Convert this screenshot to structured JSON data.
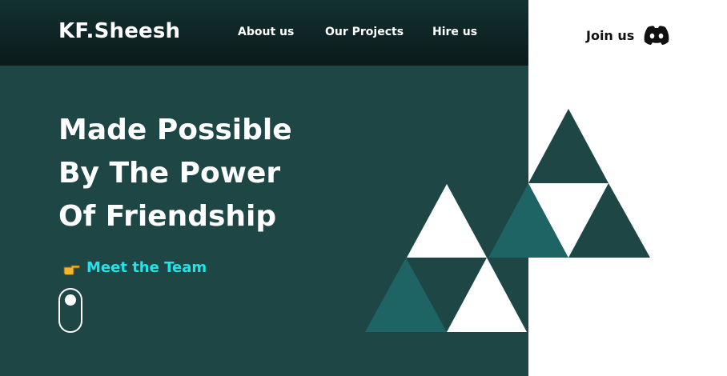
{
  "brand": {
    "name": "KF.Sheesh"
  },
  "nav": {
    "links": [
      {
        "label": "About us"
      },
      {
        "label": "Our Projects"
      },
      {
        "label": "Hire us"
      }
    ],
    "join_label": "Join us",
    "join_icon": "discord-icon"
  },
  "hero": {
    "headline_lines": [
      "Made Possible",
      "By The Power",
      "Of Friendship"
    ],
    "cta_label": "Meet the Team",
    "cta_icon": "pointing-hand-icon"
  },
  "colors": {
    "panel_bg": "#1d4645",
    "nav_bg": "#0f2424",
    "accent_cyan": "#22e3e8",
    "triangle_dark": "#1d4645",
    "triangle_teal": "#1e6464",
    "triangle_white": "#ffffff"
  }
}
